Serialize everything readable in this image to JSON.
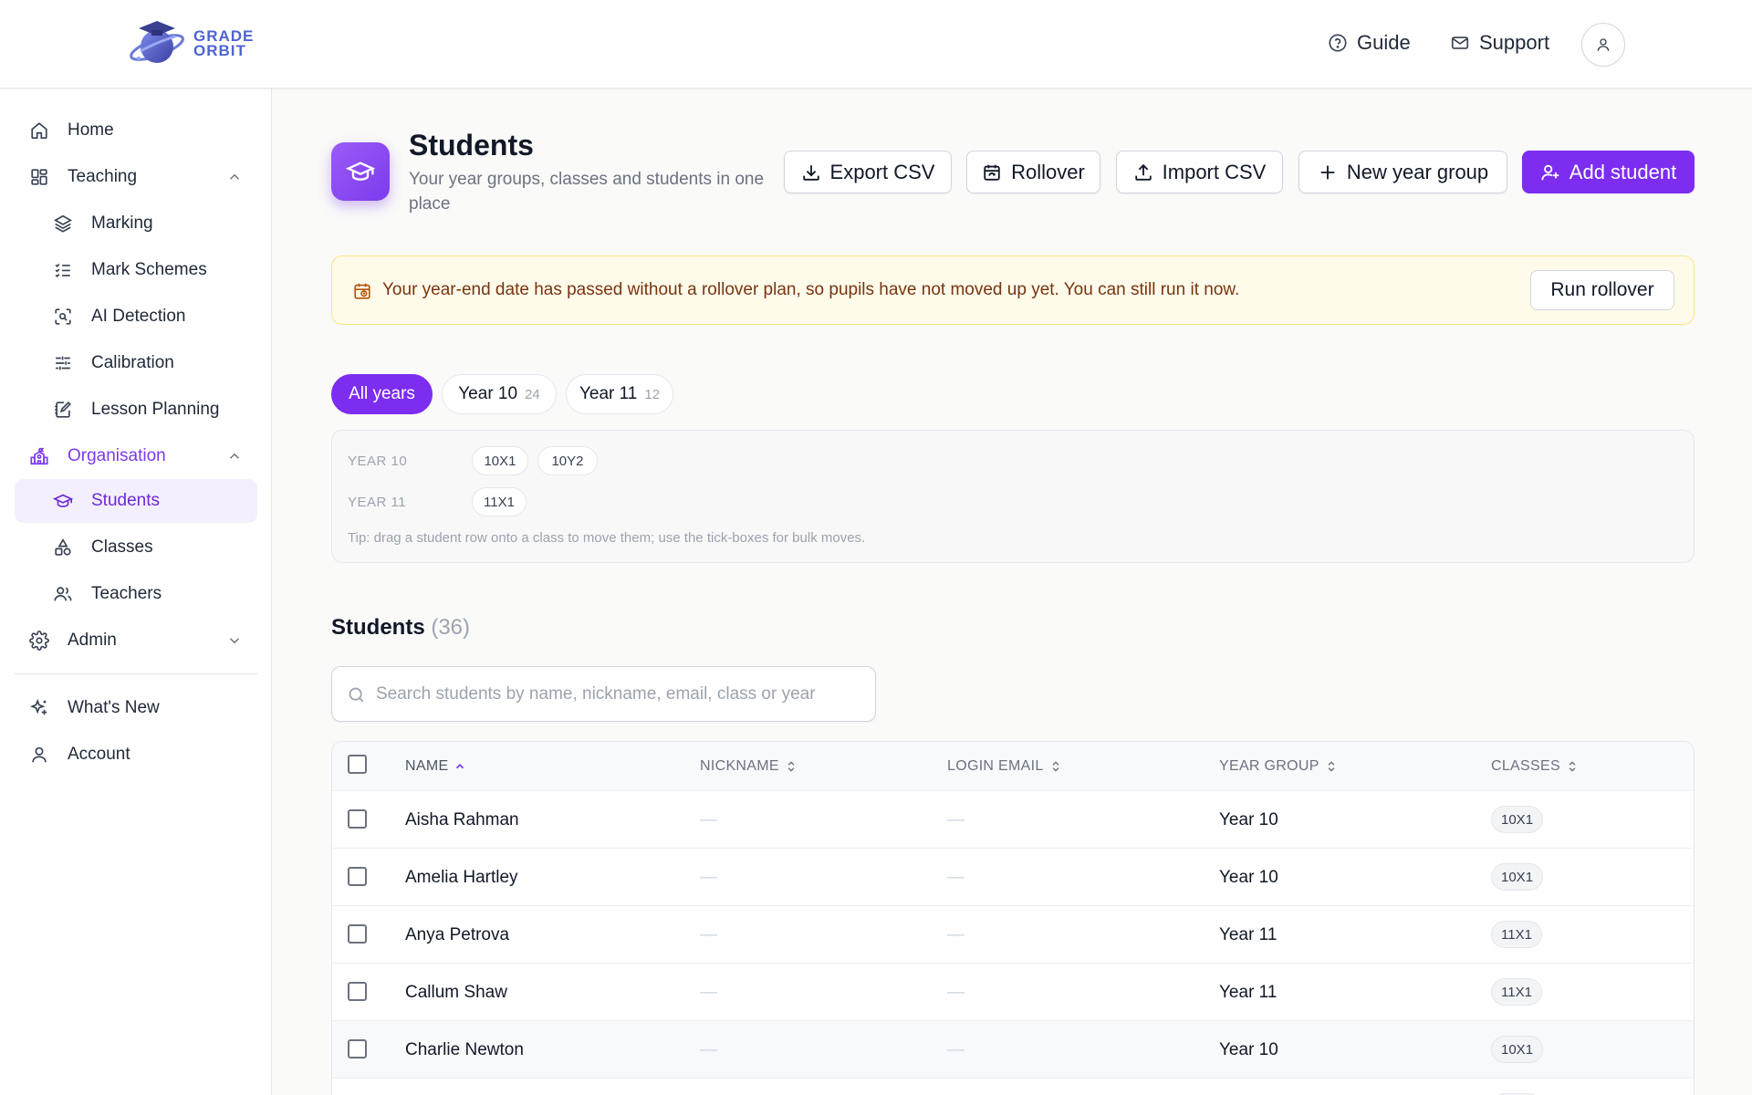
{
  "brand": {
    "line1": "GRADE",
    "line2": "ORBIT"
  },
  "header": {
    "guide": "Guide",
    "support": "Support"
  },
  "sidebar": {
    "home": "Home",
    "teaching": "Teaching",
    "marking": "Marking",
    "mark_schemes": "Mark Schemes",
    "ai_detection": "AI Detection",
    "calibration": "Calibration",
    "lesson_planning": "Lesson Planning",
    "organisation": "Organisation",
    "students": "Students",
    "classes": "Classes",
    "teachers": "Teachers",
    "admin": "Admin",
    "whats_new": "What's New",
    "account": "Account"
  },
  "page": {
    "title": "Students",
    "subtitle": "Your year groups, classes and students in one place"
  },
  "actions": {
    "export": "Export CSV",
    "rollover": "Rollover",
    "import": "Import CSV",
    "new_year_group": "New year group",
    "add_student": "Add student"
  },
  "alert": {
    "text": "Your year-end date has passed without a rollover plan, so pupils have not moved up yet. You can still run it now.",
    "button": "Run rollover"
  },
  "filters": {
    "all": "All years",
    "years": [
      {
        "label": "Year 10",
        "count": "24"
      },
      {
        "label": "Year 11",
        "count": "12"
      }
    ]
  },
  "classes_panel": {
    "rows": [
      {
        "label": "YEAR 10",
        "classes": [
          "10X1",
          "10Y2"
        ]
      },
      {
        "label": "YEAR 11",
        "classes": [
          "11X1"
        ]
      }
    ],
    "tip": "Tip: drag a student row onto a class to move them; use the tick-boxes for bulk moves."
  },
  "students_section": {
    "title": "Students",
    "count": "(36)",
    "search_placeholder": "Search students by name, nickname, email, class or year"
  },
  "table": {
    "columns": [
      "NAME",
      "NICKNAME",
      "LOGIN EMAIL",
      "YEAR GROUP",
      "CLASSES"
    ],
    "rows": [
      {
        "name": "Aisha Rahman",
        "nickname": "—",
        "email": "—",
        "year": "Year 10",
        "class": "10X1"
      },
      {
        "name": "Amelia Hartley",
        "nickname": "—",
        "email": "—",
        "year": "Year 10",
        "class": "10X1"
      },
      {
        "name": "Anya Petrova",
        "nickname": "—",
        "email": "—",
        "year": "Year 11",
        "class": "11X1"
      },
      {
        "name": "Callum Shaw",
        "nickname": "—",
        "email": "—",
        "year": "Year 11",
        "class": "11X1"
      },
      {
        "name": "Charlie Newton",
        "nickname": "—",
        "email": "—",
        "year": "Year 10",
        "class": "10X1"
      },
      {
        "name": "",
        "nickname": "",
        "email": "",
        "year": "",
        "class": ""
      }
    ]
  },
  "colors": {
    "accent": "#7c2df0",
    "alert_bg": "#fffbeb",
    "alert_text": "#78350f"
  }
}
